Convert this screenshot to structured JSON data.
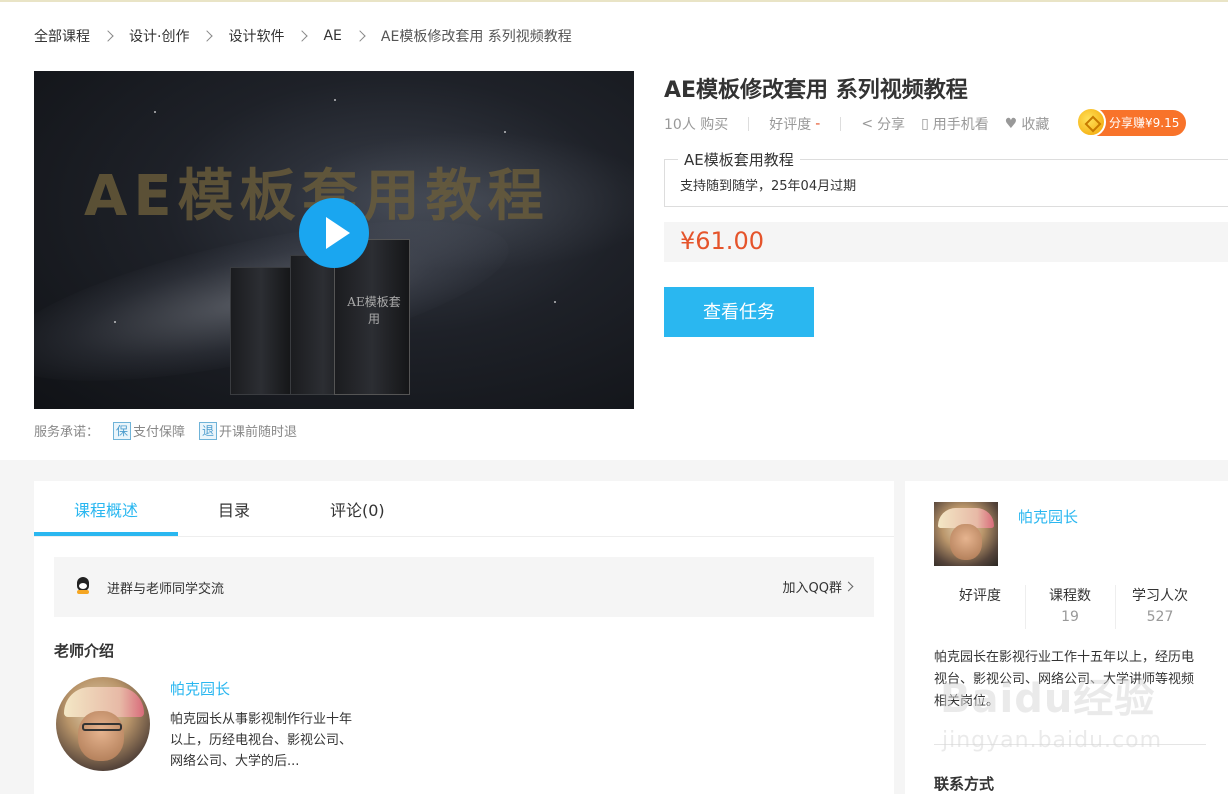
{
  "breadcrumb": {
    "items": [
      "全部课程",
      "设计·创作",
      "设计软件",
      "AE"
    ],
    "current": "AE模板修改套用 系列视频教程"
  },
  "video": {
    "overlay_title": "AE模板套用教程",
    "book_title": "AE模板套用"
  },
  "course": {
    "title": "AE模板修改套用 系列视频教程",
    "buyers": "10人 购买",
    "rating_label": "好评度",
    "rating_value": "-",
    "share": "分享",
    "mobile": "用手机看",
    "favorite": "收藏",
    "share_earn": "分享赚¥9.15",
    "plan_label": "AE模板套用教程",
    "plan_desc": "支持随到随学，25年04月过期",
    "price": "¥61.00",
    "cta": "查看任务"
  },
  "service": {
    "label": "服务承诺：",
    "items": [
      {
        "icon": "保",
        "text": "支付保障"
      },
      {
        "icon": "退",
        "text": "开课前随时退"
      }
    ]
  },
  "tabs": [
    "课程概述",
    "目录",
    "评论(0)"
  ],
  "qq": {
    "text": "进群与老师同学交流",
    "join": "加入QQ群"
  },
  "teacher": {
    "section_title": "老师介绍",
    "name": "帕克园长",
    "bio": "帕克园长从事影视制作行业十年以上，历经电视台、影视公司、网络公司、大学的后..."
  },
  "sidebar": {
    "name": "帕克园长",
    "stats": [
      {
        "label": "好评度",
        "value": ""
      },
      {
        "label": "课程数",
        "value": "19"
      },
      {
        "label": "学习人次",
        "value": "527"
      }
    ],
    "bio": "帕克园长在影视行业工作十五年以上，经历电视台、影视公司、网络公司、大学讲师等视频相关岗位。",
    "contact_title": "联系方式"
  },
  "watermark": {
    "brand": "Baidu经验",
    "url": "jingyan.baidu.com"
  },
  "colors": {
    "accent": "#2ab7f0",
    "price": "#e5542b",
    "share_earn": "#f8732a"
  }
}
